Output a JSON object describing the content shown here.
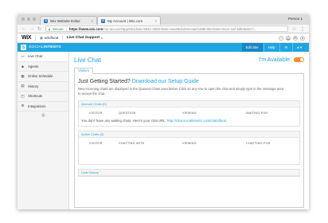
{
  "browser": {
    "tabs": [
      {
        "label": "Wix Website Editor",
        "favicon": "W"
      },
      {
        "label": "My Account | Wix.com",
        "favicon": "W"
      }
    ],
    "profile": "Person 1",
    "address": {
      "secure_label": "Secure",
      "url_bold": "https://www.wix.com",
      "url_rest": "/my-account/app/651d16e-864e-4300-8e6e-aea36d1d54ceaa/1388c80d-b8ee-0ec2-1af-3d935a817..."
    }
  },
  "wix": {
    "logo": "WiX",
    "site_name": "arloflood",
    "app_name": "Live Chat Support"
  },
  "app_header": {
    "brand_prefix": "SOCIAL",
    "brand_suffix": "INTENTS",
    "edit_site": "Edit Site",
    "help": "Help"
  },
  "sidebar": {
    "items": [
      {
        "label": "Live Chat",
        "icon": "chat-icon"
      },
      {
        "label": "Agents",
        "icon": "agents-icon"
      },
      {
        "label": "Online Schedule",
        "icon": "calendar-icon"
      },
      {
        "label": "History",
        "icon": "history-icon"
      },
      {
        "label": "Shortcuts",
        "icon": "shortcuts-icon"
      },
      {
        "label": "Integrations",
        "icon": "integrations-icon"
      }
    ]
  },
  "main": {
    "title": "Live Chat",
    "availability": "I'm Available:",
    "available_on": true,
    "tab": "Visitors",
    "getting_started": "Just Getting Started?",
    "setup_link": "Download our Setup Guide",
    "intro": "New incoming chats are displayed in the Queued Chats area below. Click on any row to open the chat and simply type in the message area to accept the chat.",
    "queued": {
      "title": "Queued Chats (0)",
      "columns": [
        "VISITOR",
        "QUESTION",
        "VIEWING",
        "WAITING FOR"
      ],
      "empty_text": "You don't have any waiting chats. Here's your chat URL:",
      "chat_url": "http://chat.socialintents.com/c/arloflood"
    },
    "active": {
      "title": "Active Chats (0)",
      "columns": [
        "VISITOR",
        "CHATTING WITH",
        "VIEWING",
        "CHATTING FOR"
      ]
    },
    "history_title": "Chat History"
  },
  "colors": {
    "accent": "#1fa5e1",
    "toggle": "#f28a2a"
  }
}
